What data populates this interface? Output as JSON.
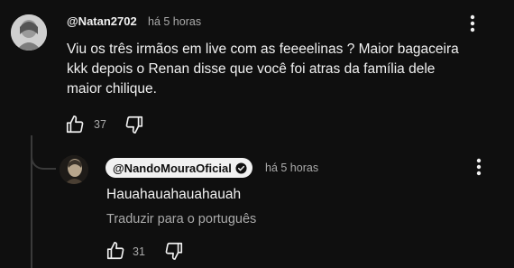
{
  "comment": {
    "handle": "@Natan2702",
    "time": "há 5 horas",
    "text_lines": [
      "Viu os três irmãos em live com as feeeelinas ? Maior bagaceira",
      "kkk depois o Renan disse que você foi atras da família dele",
      "maior chilique."
    ],
    "likes": "37"
  },
  "reply": {
    "handle": "@NandoMouraOficial",
    "time": "há 5 horas",
    "text": "Hauahauahauahauah",
    "translate_label": "Traduzir para o português",
    "likes": "31"
  }
}
